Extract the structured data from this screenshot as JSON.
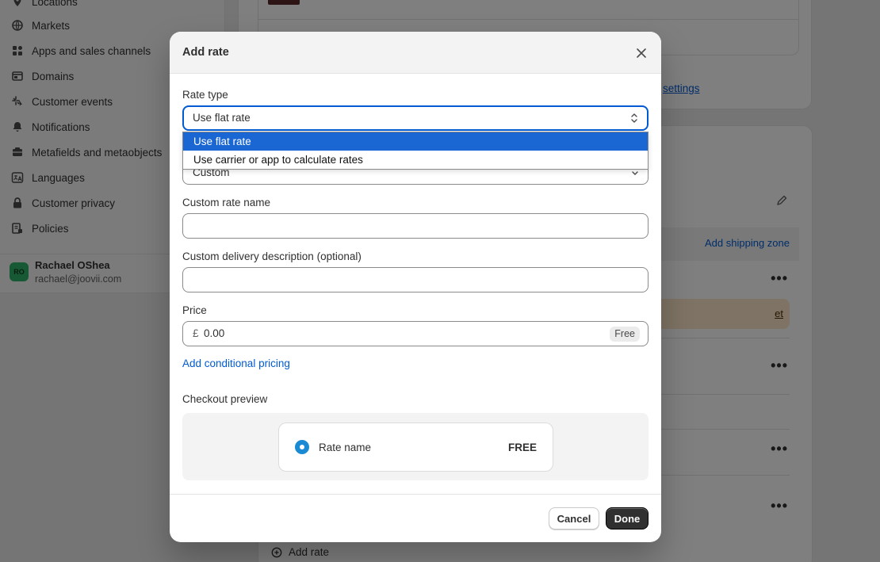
{
  "sidebar": {
    "items": [
      {
        "label": "Locations",
        "icon": "location-pin-icon"
      },
      {
        "label": "Markets",
        "icon": "globe-icon"
      },
      {
        "label": "Apps and sales channels",
        "icon": "apps-icon"
      },
      {
        "label": "Domains",
        "icon": "domain-icon"
      },
      {
        "label": "Customer events",
        "icon": "sparkle-icon"
      },
      {
        "label": "Notifications",
        "icon": "bell-icon"
      },
      {
        "label": "Metafields and metaobjects",
        "icon": "metafields-icon"
      },
      {
        "label": "Languages",
        "icon": "language-icon"
      },
      {
        "label": "Customer privacy",
        "icon": "lock-icon"
      },
      {
        "label": "Policies",
        "icon": "policies-icon"
      }
    ],
    "user": {
      "initials": "RO",
      "name": "Rachael OShea",
      "email": "rachael@joovii.com"
    }
  },
  "background": {
    "settings_link": "settings",
    "add_shipping_zone": "Add shipping zone",
    "warning_link": "et",
    "add_rate": "Add rate"
  },
  "modal": {
    "title": "Add rate",
    "rate_type": {
      "label": "Rate type",
      "value": "Use flat rate",
      "options": [
        "Use flat rate",
        "Use carrier or app to calculate rates"
      ]
    },
    "hidden_select_value": "Custom",
    "custom_rate_name": {
      "label": "Custom rate name",
      "value": ""
    },
    "custom_delivery_description": {
      "label": "Custom delivery description (optional)",
      "value": ""
    },
    "price": {
      "label": "Price",
      "currency": "£",
      "value": "0.00",
      "badge": "Free"
    },
    "conditional_pricing_link": "Add conditional pricing",
    "checkout_preview": {
      "label": "Checkout preview",
      "rate_name": "Rate name",
      "rate_price": "FREE"
    },
    "buttons": {
      "cancel": "Cancel",
      "done": "Done"
    }
  },
  "colors": {
    "primary_blue": "#005bd3",
    "selected_option": "#1a66d2",
    "done_button": "#303030"
  }
}
